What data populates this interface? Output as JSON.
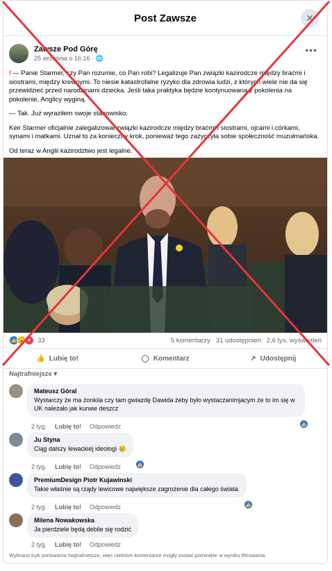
{
  "header": {
    "title": "Post Zawsze",
    "close_icon": "close-icon"
  },
  "post": {
    "author": "Zawsze Pod Górę",
    "date": "25 września o 16:16 ·",
    "paragraphs": [
      "— Panie Starmer, czy Pan rozumie, co Pan robi? Legalizuje Pan związki kazirodcze między braćmi i siostrami, między krewnymi. To niesie katastrofalne ryzyko dla zdrowia ludzi, z których wiele nie da się przewidzieć przed narodzinami dziecka. Jeśli taka praktyka będzie kontynuowana z pokolenia na pokolenie, Anglicy wyginą.",
      "— Tak. Już wyraziłem swoje stanowisko.",
      "Keir Starmer oficjalnie zalegalizował związki kazirodcze między braćmi i siostrami, ojcami i córkami, synami i matkami. Uznał to za konieczny krok, ponieważ tego zażyczyła sobie społeczność muzułmańska.",
      "Od teraz w Anglii kazirodztwo jest legalne."
    ]
  },
  "stats": {
    "reactions": "33",
    "comments": "5 komentarzy",
    "shares": "31 udostępnień",
    "views": "2,6 tys. wyświetleń"
  },
  "actions": {
    "like": "Lubię to!",
    "comment": "Komentarz",
    "share": "Udostępnij"
  },
  "sort_label": "Najtrafniejsze ▾",
  "comments": [
    {
      "name": "Mateusz Góral",
      "text": "Wystarczy że ma żonkila czy tam gwiazdę Dawida żeby było wystaczanimjacym że to im się w UK należało jak kurwie deszcz",
      "time": "2 tyg.",
      "like": "Lubię to!",
      "reply": "Odpowiedz"
    },
    {
      "name": "Ju Styna",
      "text": "Ciąg dalszy lewackiej ideologi 😢",
      "time": "2 tyg.",
      "like": "Lubię to!",
      "reply": "Odpowiedz"
    },
    {
      "name": "PremiumDesign Piotr Kujawinski",
      "text": "Takie właśnie są rządy lewicowe największe zagrożenie dla całego świata.",
      "time": "2 tyg.",
      "like": "Lubię to!",
      "reply": "Odpowiedz"
    },
    {
      "name": "Milena Nowakowska",
      "text": "Ja pierdziele będą debile się rodzić",
      "time": "2 tyg.",
      "like": "Lubię to!",
      "reply": "Odpowiedz"
    }
  ],
  "footer_note": "Wybrano tryb sortowania Najtrafniejsze, więc niektóre komentarze mogły zostać pominięte w wyniku filtrowania.",
  "colors": {
    "accent": "#1877f2",
    "cross": "#e8333a",
    "exclamation": "#e41e3f"
  }
}
